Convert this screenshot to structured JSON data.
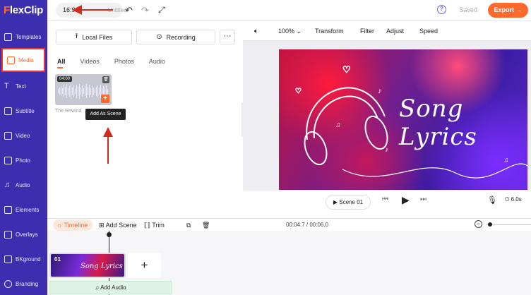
{
  "app": {
    "logo": "FlexClip"
  },
  "sidebar": {
    "items": [
      {
        "label": "Templates"
      },
      {
        "label": "Media"
      },
      {
        "label": "Text"
      },
      {
        "label": "Subtitle"
      },
      {
        "label": "Video"
      },
      {
        "label": "Photo"
      },
      {
        "label": "Audio"
      },
      {
        "label": "Elements"
      },
      {
        "label": "Overlays"
      },
      {
        "label": "BKground"
      },
      {
        "label": "Branding"
      }
    ]
  },
  "topbar": {
    "ratio": "16:9",
    "project_name": "Untitled",
    "saved": "Saved",
    "export": "Export"
  },
  "media": {
    "local_files": "Local Files",
    "recording": "Recording",
    "more": "···",
    "tabs": [
      "All",
      "Videos",
      "Photos",
      "Audio"
    ],
    "item": {
      "duration": "04:00",
      "name": "The Rewind"
    },
    "tooltip": "Add As Scene"
  },
  "preview": {
    "toolbar": {
      "zoom": "100%",
      "transform": "Transform",
      "filter": "Filter",
      "adjust": "Adjust",
      "speed": "Speed"
    },
    "video_title": "Song Lyrics",
    "scene_label": "Scene 01",
    "duration": "6.0s"
  },
  "timeline": {
    "timeline_label": "Timeline",
    "add_scene": "Add Scene",
    "trim": "Trim",
    "time": "00:04.7 / 00:06.0",
    "clip_no": "01",
    "clip_title": "Song Lyrics",
    "add_audio": "Add Audio",
    "add_plus": "+"
  },
  "colors": {
    "accent": "#ff6a2c",
    "sidebar": "#3b2fb0",
    "annotation": "#d52b1e"
  }
}
